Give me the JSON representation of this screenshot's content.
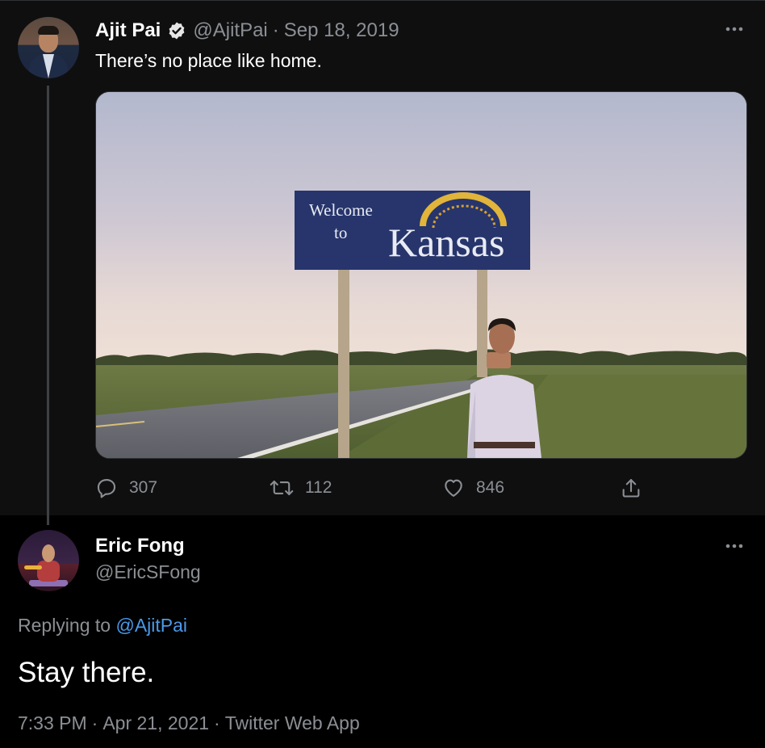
{
  "parent_tweet": {
    "author_name": "Ajit Pai",
    "handle": "@AjitPai",
    "date": "Sep 18, 2019",
    "separator": "·",
    "more_label": "•••",
    "text": "There’s no place like home.",
    "image": {
      "sign_line1": "Welcome",
      "sign_line2": "to",
      "sign_state": "Kansas"
    },
    "stats": {
      "replies": "307",
      "retweets": "112",
      "likes": "846"
    }
  },
  "reply_tweet": {
    "author_name": "Eric Fong",
    "handle": "@EricSFong",
    "more_label": "•••",
    "replying_prefix": "Replying to",
    "replying_to": "@AjitPai",
    "text": "Stay there.",
    "time": "7:33 PM",
    "date": "Apr 21, 2021",
    "source": "Twitter Web App",
    "separator": "·"
  },
  "colors": {
    "background": "#000000",
    "parent_background": "#0f0f10",
    "text_primary": "#ffffff",
    "text_secondary": "#8b8f94",
    "link": "#4a99e9",
    "verified_badge": "#e6e6e6"
  },
  "icons": {
    "verified": "verified-badge-icon",
    "reply": "reply-bubble-icon",
    "retweet": "retweet-icon",
    "like": "heart-icon",
    "share": "share-upload-icon",
    "more": "more-dots-icon"
  }
}
